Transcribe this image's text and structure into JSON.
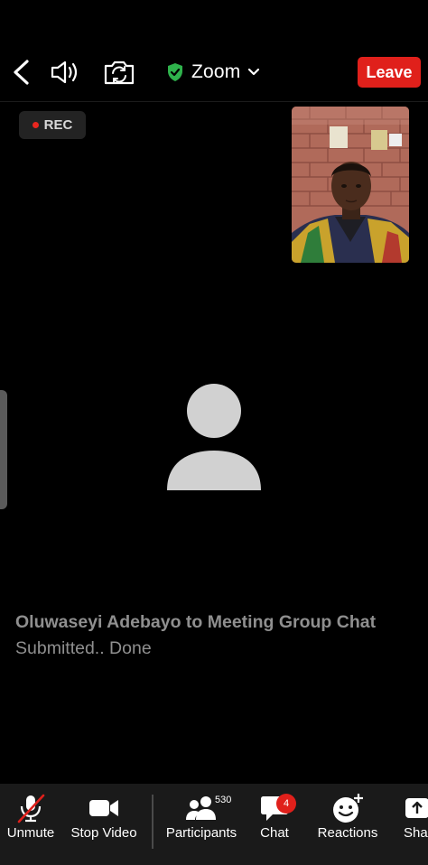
{
  "header": {
    "title": "Zoom",
    "leave_label": "Leave",
    "icons": {
      "back": "chevron-left-icon",
      "speaker": "speaker-icon",
      "camera_switch": "camera-switch-icon",
      "security": "shield-check-icon",
      "title_dropdown": "chevron-down-icon"
    },
    "colors": {
      "leave_bg": "#e0201b",
      "shield": "#2fb24c"
    }
  },
  "recording": {
    "label": "REC",
    "dot_color": "#e8261f"
  },
  "main_view": {
    "avatar_icon": "person-placeholder-icon"
  },
  "chat_notification": {
    "sender": "Oluwaseyi Adebayo to Meeting Group Chat",
    "message": "Submitted.. Done"
  },
  "toolbar": {
    "items": [
      {
        "label": "Unmute",
        "icon": "microphone-muted-icon"
      },
      {
        "label": "Stop Video",
        "icon": "video-camera-icon"
      },
      {
        "label": "Participants",
        "icon": "participants-icon",
        "count": "530"
      },
      {
        "label": "Chat",
        "icon": "chat-bubble-icon",
        "badge": "4"
      },
      {
        "label": "Reactions",
        "icon": "reaction-smiley-icon"
      },
      {
        "label": "Shar",
        "icon": "share-icon"
      }
    ]
  }
}
